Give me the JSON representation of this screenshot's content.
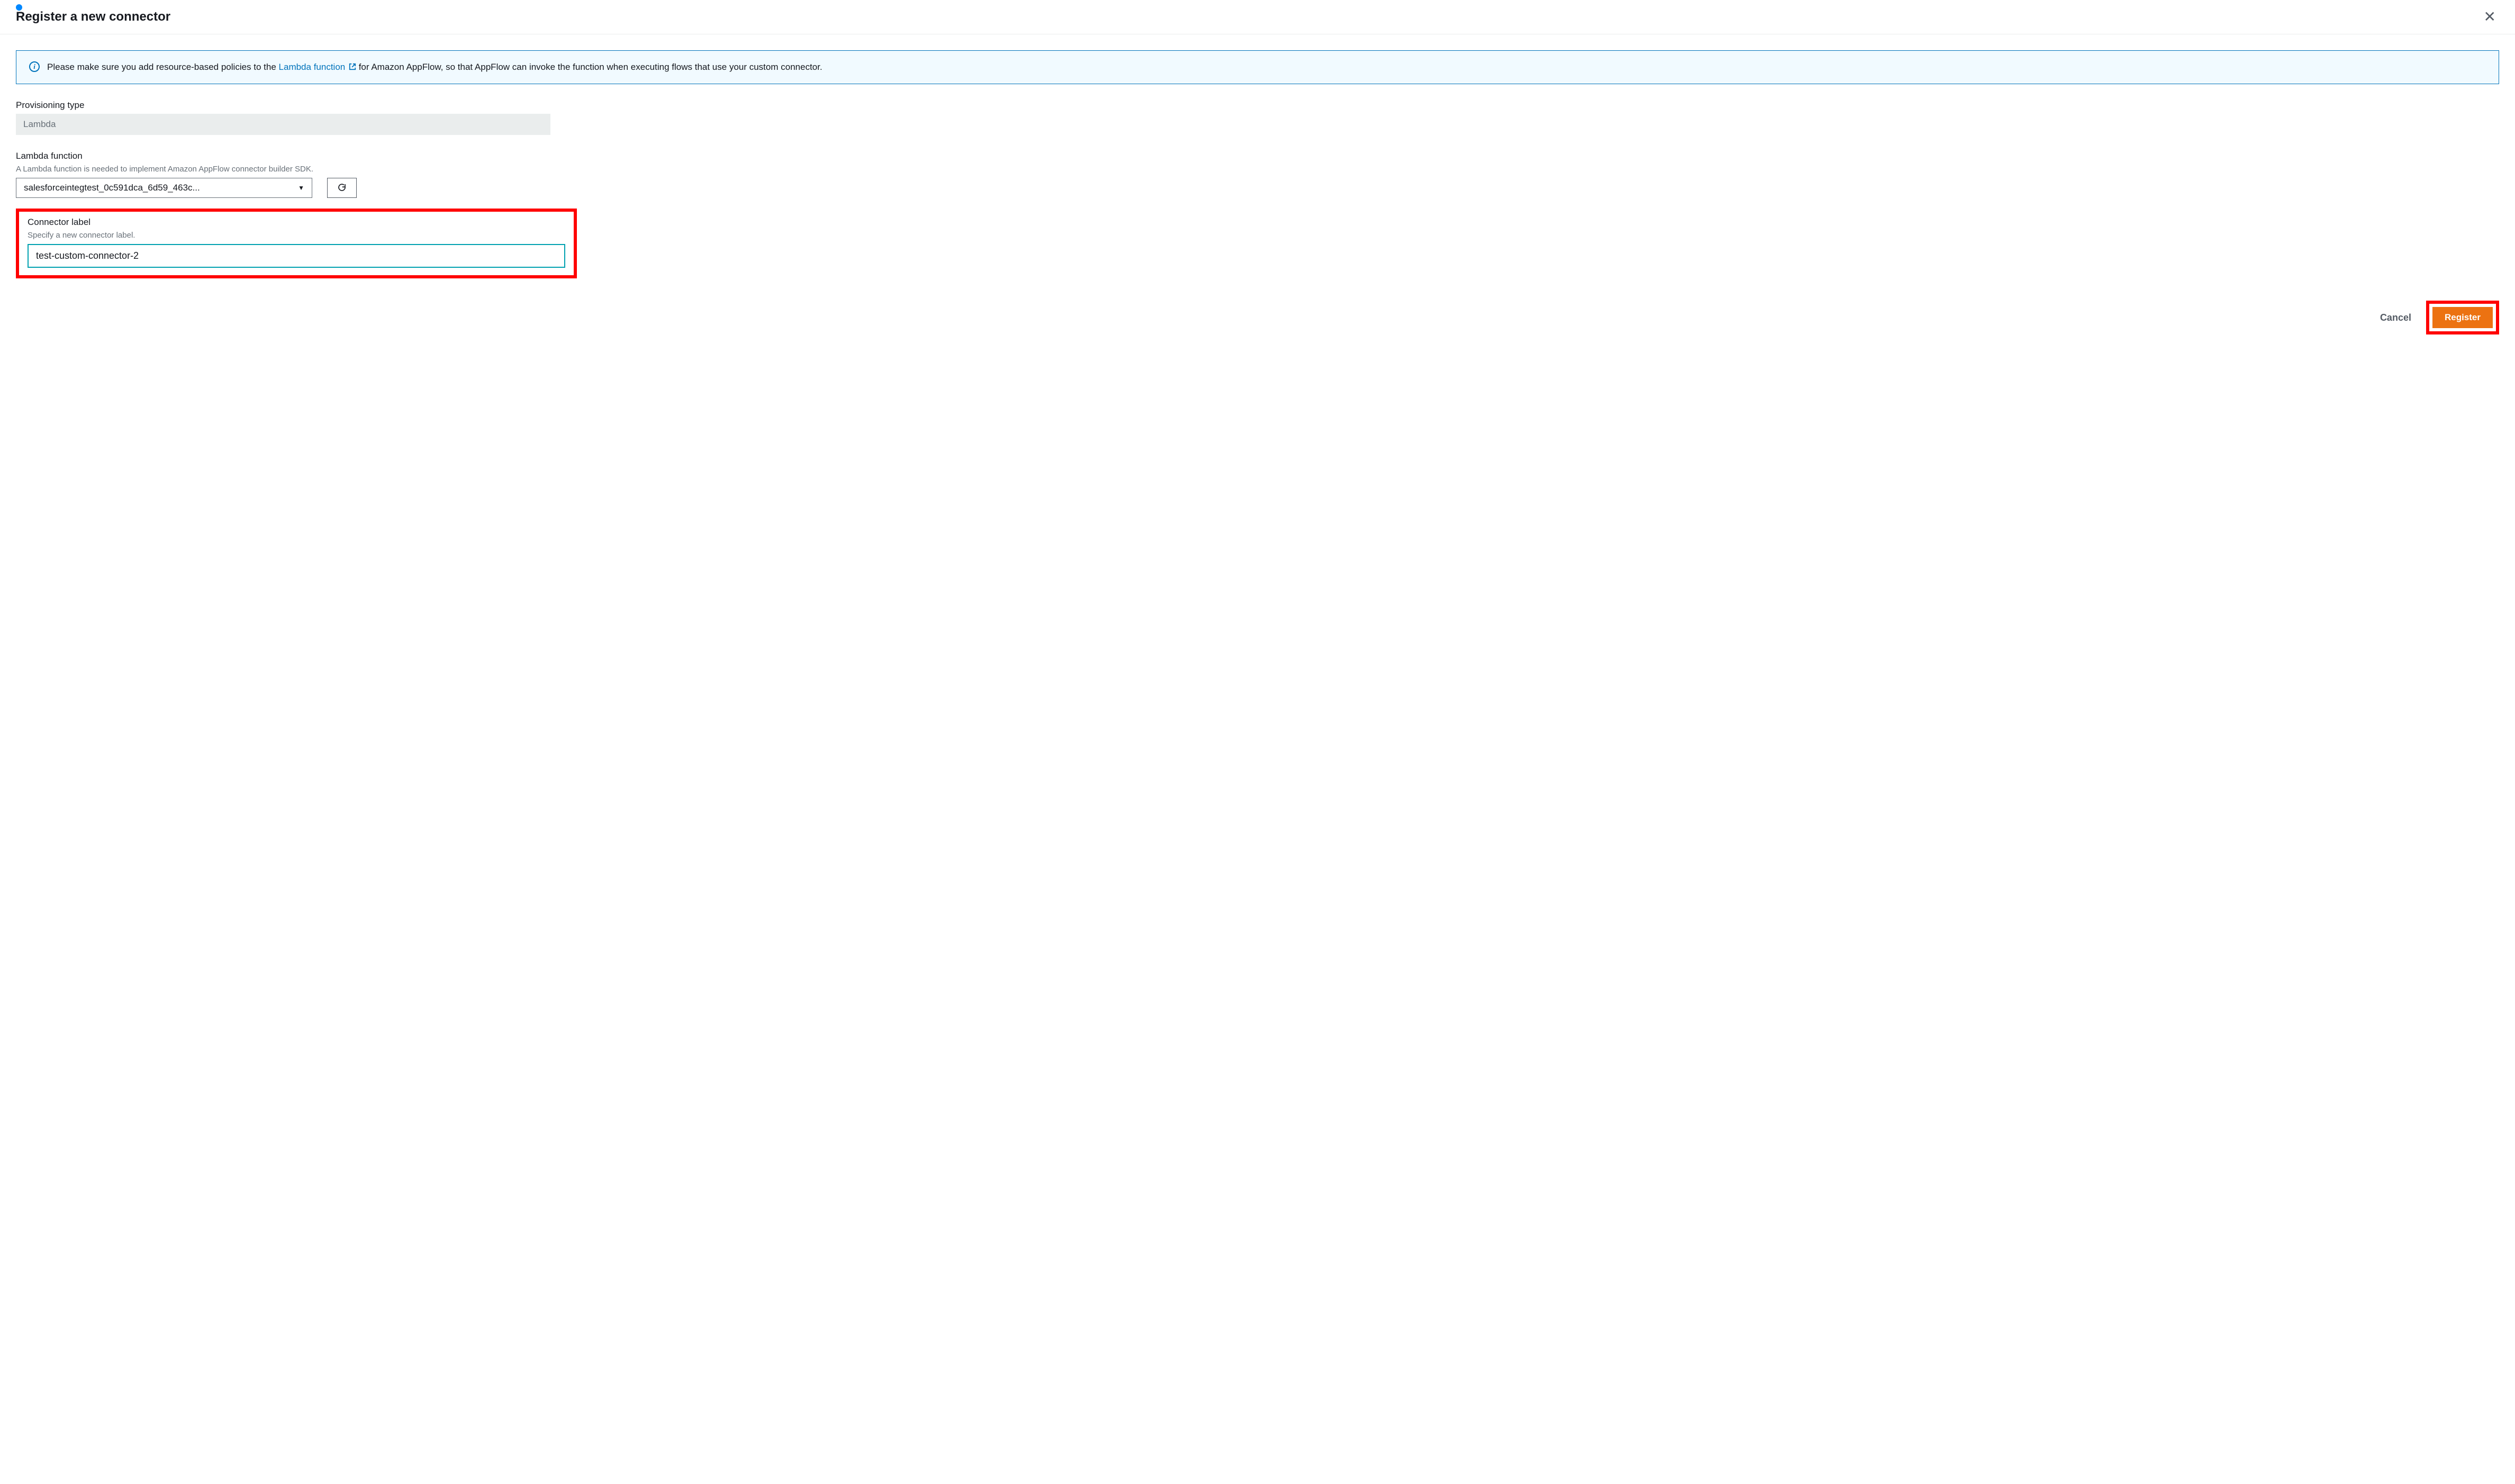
{
  "header": {
    "title": "Register a new connector"
  },
  "info": {
    "text_pre": "Please make sure you add resource-based policies to the ",
    "link_text": "Lambda function",
    "text_post": " for Amazon AppFlow, so that AppFlow can invoke the function when executing flows that use your custom connector."
  },
  "provisioning": {
    "label": "Provisioning type",
    "value": "Lambda"
  },
  "lambda": {
    "label": "Lambda function",
    "hint": "A Lambda function is needed to implement Amazon AppFlow connector builder SDK.",
    "selected": "salesforceintegtest_0c591dca_6d59_463c... "
  },
  "connector_label": {
    "label": "Connector label",
    "hint": "Specify a new connector label.",
    "value": "test-custom-connector-2"
  },
  "footer": {
    "cancel": "Cancel",
    "register": "Register"
  }
}
